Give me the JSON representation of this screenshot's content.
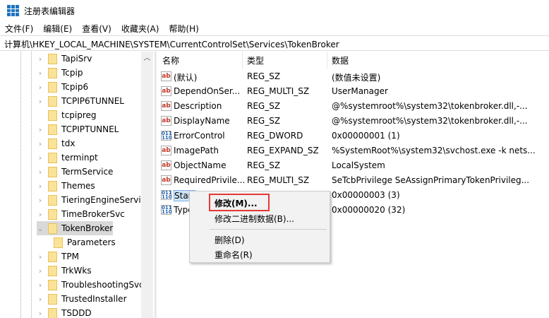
{
  "window": {
    "title": "注册表编辑器"
  },
  "menu": [
    "文件(F)",
    "编辑(E)",
    "查看(V)",
    "收藏夹(A)",
    "帮助(H)"
  ],
  "address": "计算机\\HKEY_LOCAL_MACHINE\\SYSTEM\\CurrentControlSet\\Services\\TokenBroker",
  "tree": [
    {
      "label": "TapiSrv",
      "chev": "›"
    },
    {
      "label": "Tcpip",
      "chev": "›"
    },
    {
      "label": "Tcpip6",
      "chev": "›"
    },
    {
      "label": "TCPIP6TUNNEL",
      "chev": "›"
    },
    {
      "label": "tcpipreg",
      "chev": ""
    },
    {
      "label": "TCPIPTUNNEL",
      "chev": "›"
    },
    {
      "label": "tdx",
      "chev": "›"
    },
    {
      "label": "terminpt",
      "chev": "›"
    },
    {
      "label": "TermService",
      "chev": "›"
    },
    {
      "label": "Themes",
      "chev": "›"
    },
    {
      "label": "TieringEngineService",
      "chev": "›"
    },
    {
      "label": "TimeBrokerSvc",
      "chev": "›"
    },
    {
      "label": "TokenBroker",
      "chev": "⌄"
    },
    {
      "label": "Parameters",
      "chev": ""
    },
    {
      "label": "TPM",
      "chev": "›"
    },
    {
      "label": "TrkWks",
      "chev": "›"
    },
    {
      "label": "TroubleshootingSvc",
      "chev": "›"
    },
    {
      "label": "TrustedInstaller",
      "chev": "›"
    },
    {
      "label": "TSDDD",
      "chev": "›"
    }
  ],
  "columns": [
    "名称",
    "类型",
    "数据"
  ],
  "values": [
    {
      "icon": "ab",
      "name": "(默认)",
      "type": "REG_SZ",
      "data": "(数值未设置)"
    },
    {
      "icon": "ab",
      "name": "DependOnSer...",
      "type": "REG_MULTI_SZ",
      "data": "UserManager"
    },
    {
      "icon": "ab",
      "name": "Description",
      "type": "REG_SZ",
      "data": "@%systemroot%\\system32\\tokenbroker.dll,-..."
    },
    {
      "icon": "ab",
      "name": "DisplayName",
      "type": "REG_SZ",
      "data": "@%systemroot%\\system32\\tokenbroker.dll,-..."
    },
    {
      "icon": "bin",
      "name": "ErrorControl",
      "type": "REG_DWORD",
      "data": "0x00000001 (1)"
    },
    {
      "icon": "ab",
      "name": "ImagePath",
      "type": "REG_EXPAND_SZ",
      "data": "%SystemRoot%\\system32\\svchost.exe -k nets..."
    },
    {
      "icon": "ab",
      "name": "ObjectName",
      "type": "REG_SZ",
      "data": "LocalSystem"
    },
    {
      "icon": "ab",
      "name": "RequiredPrivile...",
      "type": "REG_MULTI_SZ",
      "data": "SeTcbPrivilege SeAssignPrimaryTokenPrivileg..."
    },
    {
      "icon": "bin",
      "name": "Start",
      "type": "",
      "data": "0x00000003 (3)"
    },
    {
      "icon": "bin",
      "name": "Type",
      "type": "",
      "data": "0x00000020 (32)"
    }
  ],
  "context_menu": {
    "modify": "修改(M)...",
    "modify_binary": "修改二进制数据(B)...",
    "delete": "删除(D)",
    "rename": "重命名(R)"
  }
}
